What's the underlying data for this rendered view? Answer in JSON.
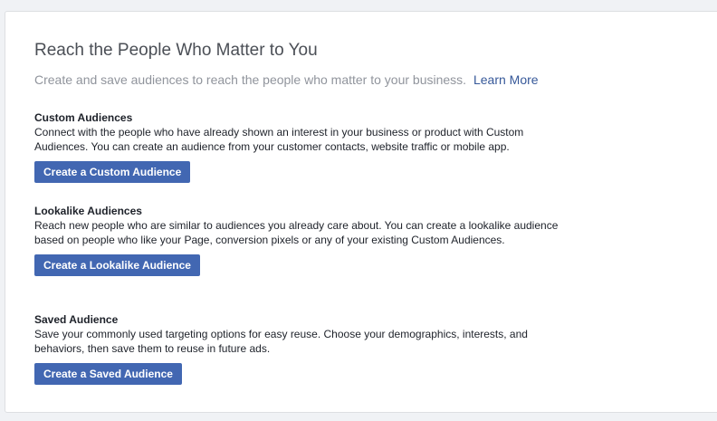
{
  "header": {
    "title": "Reach the People Who Matter to You",
    "subtitle": "Create and save audiences to reach the people who matter to your business.",
    "learn_more": "Learn More"
  },
  "sections": [
    {
      "title": "Custom Audiences",
      "description": "Connect with the people who have already shown an interest in your business or product with Custom Audiences. You can create an audience from your customer contacts, website traffic or mobile app.",
      "button": "Create a Custom Audience"
    },
    {
      "title": "Lookalike Audiences",
      "description": "Reach new people who are similar to audiences you already care about. You can create a lookalike audience based on people who like your Page, conversion pixels or any of your existing Custom Audiences.",
      "button": "Create a Lookalike Audience"
    },
    {
      "title": "Saved Audience",
      "description": "Save your commonly used targeting options for easy reuse. Choose your demographics, interests, and behaviors, then save them to reuse in future ads.",
      "button": "Create a Saved Audience"
    }
  ],
  "colors": {
    "button_bg": "#4267b2",
    "link": "#365899",
    "muted_text": "#90949c",
    "title_text": "#4b4f56"
  }
}
